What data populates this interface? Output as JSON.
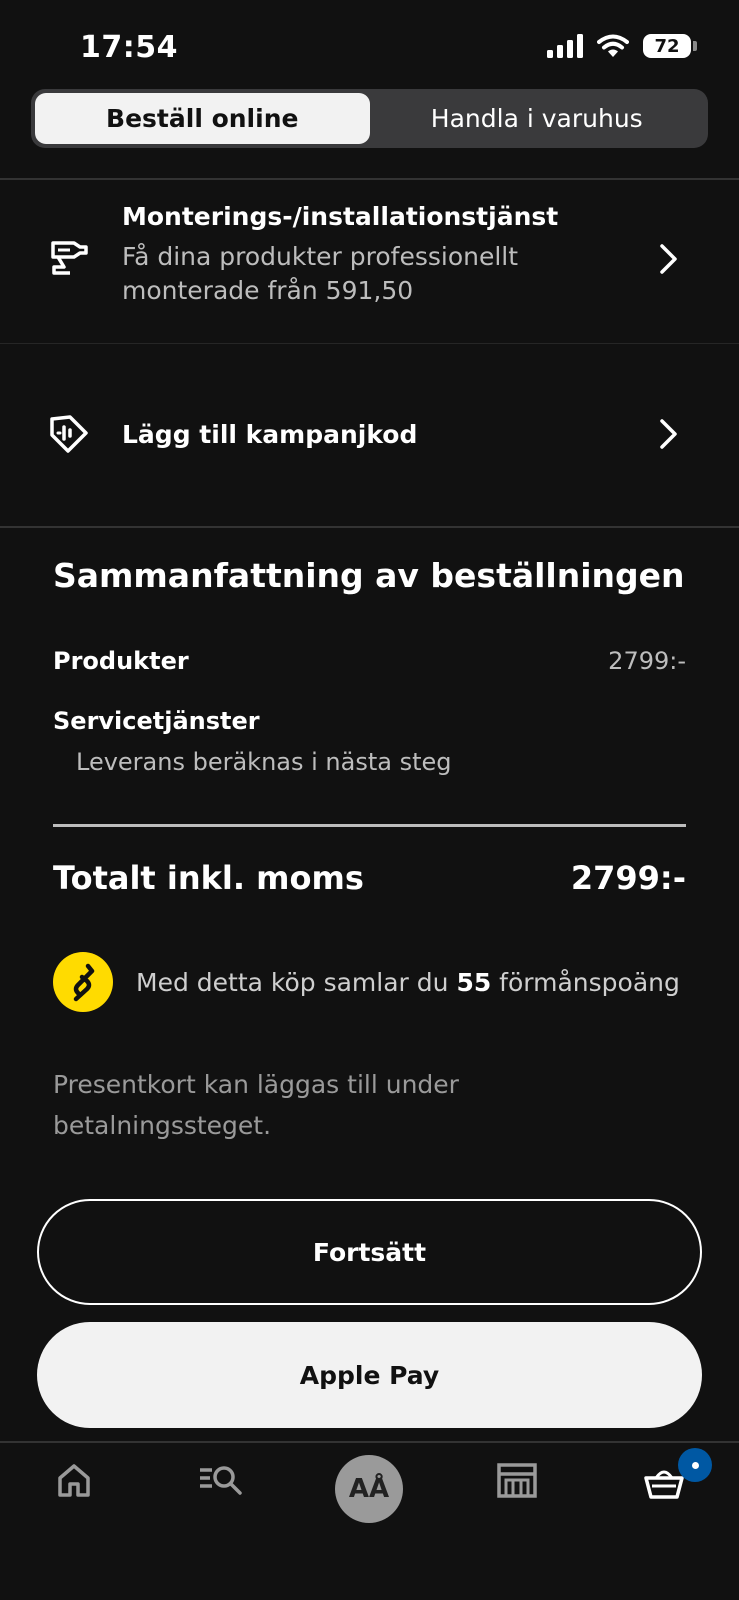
{
  "status_bar": {
    "time": "17:54",
    "battery": "72"
  },
  "segmented": {
    "tabs": [
      {
        "label": "Beställ online",
        "active": true
      },
      {
        "label": "Handla i varuhus",
        "active": false
      }
    ]
  },
  "service_rows": {
    "assembly": {
      "title": "Monterings-/installationstjänst",
      "subtitle": "Få dina produkter professionellt monterade från 591,50",
      "icon": "drill-icon"
    },
    "promo": {
      "title": "Lägg till kampanjkod",
      "icon": "tag-icon"
    }
  },
  "summary": {
    "title": "Sammanfattning av beställningen",
    "products_label": "Produkter",
    "products_value": "2799:-",
    "services_label": "Servicetjänster",
    "services_note": "Leverans beräknas i nästa steg",
    "total_label": "Totalt inkl. moms",
    "total_value": "2799:-"
  },
  "loyalty": {
    "text_before": "Med detta köp samlar du ",
    "points": "55",
    "text_after": " förmånspoäng",
    "badge_color": "#ffdb00"
  },
  "giftcard_note": "Presentkort kan läggas till under betalningssteget.",
  "buttons": {
    "continue_label": "Fortsätt",
    "applepay_label": "Apple Pay"
  },
  "tabbar": {
    "items": [
      "home-icon",
      "search-icon",
      "profile-avatar",
      "store-icon",
      "cart-icon"
    ],
    "profile_initials": "AÅ",
    "cart_badge_color": "#0058a3"
  }
}
